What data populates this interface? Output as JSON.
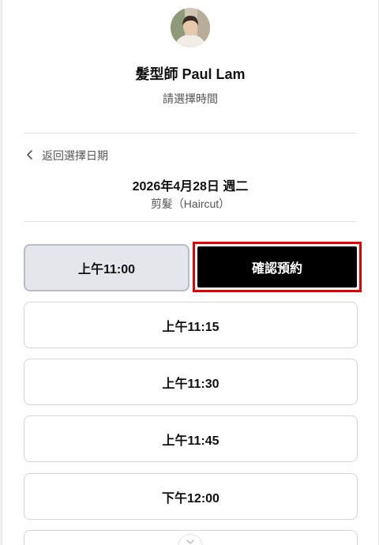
{
  "header": {
    "title": "髮型師 Paul Lam",
    "subtitle": "請選擇時間"
  },
  "navigation": {
    "back_label": "返回選擇日期"
  },
  "booking": {
    "date": "2026年4月28日 週二",
    "service": "剪髮（Haircut）"
  },
  "slots": {
    "selected_time": "上午11:00",
    "confirm_label": "確認預約",
    "items": [
      {
        "label": "上午11:15"
      },
      {
        "label": "上午11:30"
      },
      {
        "label": "上午11:45"
      },
      {
        "label": "下午12:00"
      }
    ]
  },
  "icons": {
    "back": "chevron-left-icon",
    "avatar": "profile-photo",
    "scroll": "scroll-down-icon"
  },
  "colors": {
    "confirm_bg": "#000000",
    "confirm_highlight": "#e10000",
    "selected_bg": "#e4e6ec"
  }
}
